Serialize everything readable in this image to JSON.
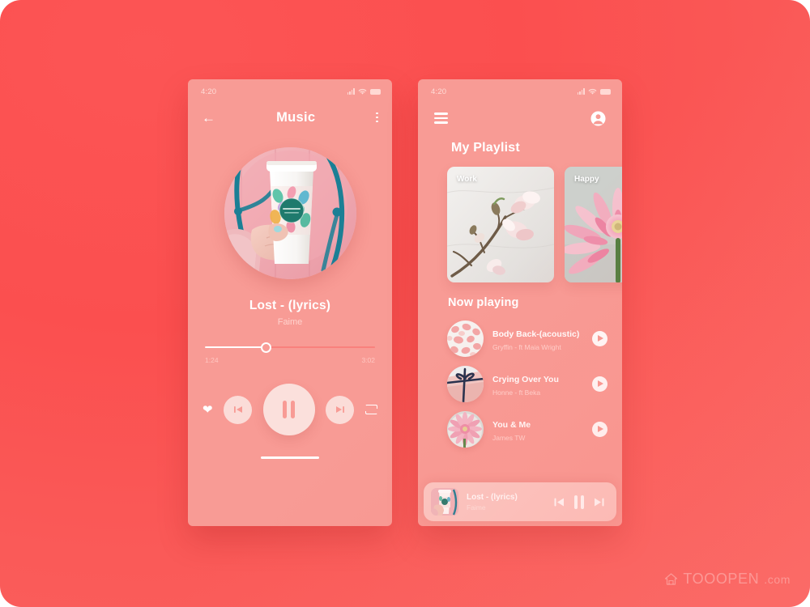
{
  "background": {
    "accent": "#fa4f4f",
    "phone_bg": "#f89b95"
  },
  "watermark": {
    "text": "TOOOPEN",
    "suffix": ".com",
    "icon": "cloud-home-icon"
  },
  "player_screen": {
    "status": {
      "time": "4:20",
      "signal_icon": "signal-icon",
      "wifi_icon": "wifi-icon",
      "battery_icon": "battery-icon"
    },
    "nav": {
      "back_icon": "back-arrow-icon",
      "title": "Music",
      "menu_icon": "kebab-menu-icon"
    },
    "album_art": {
      "alt": "hand holding white coffee cup with tropical leaf sleeve by a teal bicycle"
    },
    "track": {
      "title": "Lost - (lyrics)",
      "artist": "Faime"
    },
    "progress": {
      "elapsed": "1:24",
      "duration": "3:02",
      "percent": 36
    },
    "controls": {
      "favorite_icon": "heart-icon",
      "previous_icon": "skip-previous-icon",
      "pause_icon": "pause-icon",
      "next_icon": "skip-next-icon",
      "repeat_icon": "repeat-icon"
    }
  },
  "playlist_screen": {
    "status": {
      "time": "4:20",
      "signal_icon": "signal-icon",
      "wifi_icon": "wifi-icon",
      "battery_icon": "battery-icon"
    },
    "nav": {
      "menu_icon": "hamburger-menu-icon",
      "profile_icon": "user-avatar-icon"
    },
    "title": "My Playlist",
    "cards": [
      {
        "label": "Work",
        "alt": "magnolia branch blossoms on white marble"
      },
      {
        "label": "Happy",
        "alt": "pink gerbera daisy flower on grey background"
      }
    ],
    "section_title": "Now playing",
    "songs": [
      {
        "title": "Body Back-(acoustic)",
        "artist": "Gryffin - ft Maia Wright",
        "art_alt": "pink rose petals",
        "play_icon": "play-circle-icon"
      },
      {
        "title": "Crying Over You",
        "artist": "Honne - ft Beka",
        "art_alt": "pink gift box with navy ribbon",
        "play_icon": "play-circle-icon"
      },
      {
        "title": "You & Me",
        "artist": "James TW",
        "art_alt": "pink gerbera on plate",
        "play_icon": "play-circle-icon"
      }
    ],
    "miniplayer": {
      "title": "Lost - (lyrics)",
      "artist": "Faime",
      "art_alt": "coffee cup album art",
      "previous_icon": "skip-previous-icon",
      "pause_icon": "pause-icon",
      "next_icon": "skip-next-icon"
    }
  }
}
